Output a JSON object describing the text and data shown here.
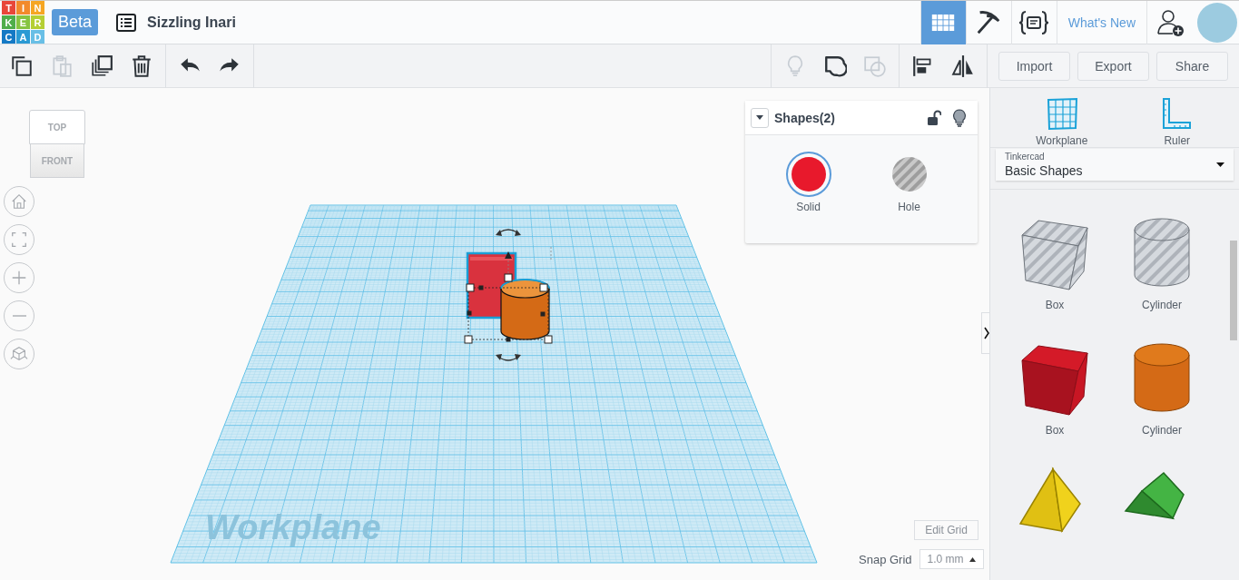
{
  "header": {
    "logo": [
      "T",
      "I",
      "N",
      "K",
      "E",
      "R",
      "C",
      "A",
      "D"
    ],
    "badge": "Beta",
    "design_title": "Sizzling Inari",
    "views": [
      {
        "selected": true
      },
      {
        "selected": false
      },
      {
        "selected": false
      }
    ],
    "whats_new": "What's New"
  },
  "toolbar": {
    "edit_tools": [
      {
        "disabled": false
      },
      {
        "disabled": true
      },
      {
        "disabled": false
      },
      {
        "disabled": false
      }
    ],
    "history_tools": [
      {
        "disabled": false
      },
      {
        "disabled": false
      }
    ],
    "shape_tools": [
      {
        "disabled": true
      },
      {
        "disabled": false
      },
      {
        "disabled": true
      }
    ],
    "arrange_tools": [
      {
        "disabled": false
      },
      {
        "disabled": false
      }
    ],
    "buttons": [
      "Import",
      "Export",
      "Share"
    ]
  },
  "view_cube": {
    "top": "TOP",
    "front": "FRONT"
  },
  "canvas": {
    "workplane_label": "Workplane",
    "edit_grid": "Edit Grid",
    "snap_grid": {
      "label": "Snap Grid",
      "value": "1.0 mm"
    }
  },
  "inspector": {
    "title": "Shapes(2)",
    "locked": false,
    "options": [
      {
        "label": "Solid",
        "selected": true
      },
      {
        "label": "Hole",
        "selected": false
      }
    ]
  },
  "sidebar": {
    "tools": [
      "Workplane",
      "Ruler"
    ],
    "library": {
      "category": "Tinkercad",
      "name": "Basic Shapes"
    },
    "shapes": [
      {
        "kind": "box",
        "hole": true,
        "label": "Box"
      },
      {
        "kind": "cylinder",
        "hole": true,
        "label": "Cylinder"
      },
      {
        "kind": "box",
        "hole": false,
        "label": "Box"
      },
      {
        "kind": "cylinder",
        "hole": false,
        "label": "Cylinder"
      },
      {
        "kind": "pyramid",
        "hole": false
      },
      {
        "kind": "roof",
        "hole": false
      }
    ]
  }
}
